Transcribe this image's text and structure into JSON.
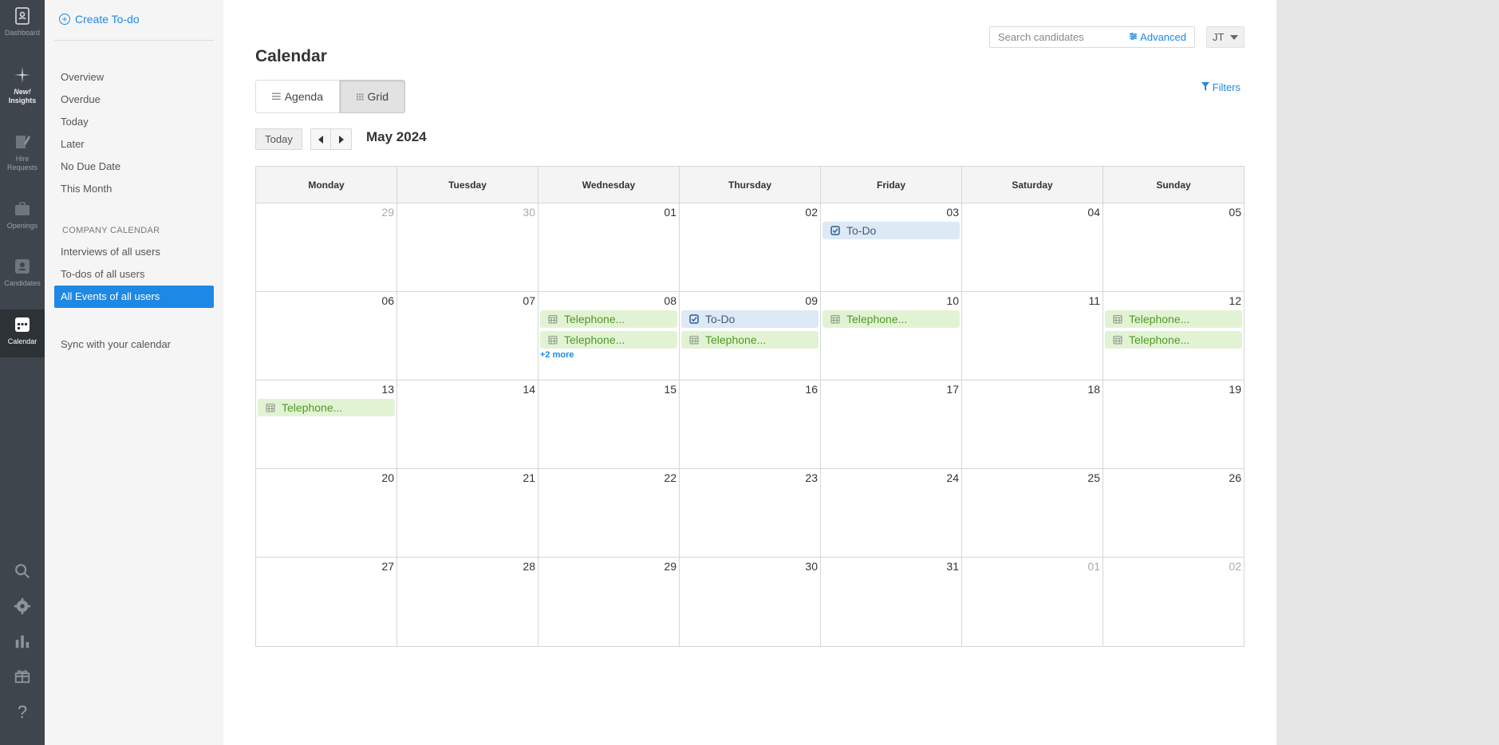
{
  "rail": {
    "items": [
      {
        "label": "Dashboard",
        "icon": "dashboard-icon"
      },
      {
        "label_top": "New!",
        "label": "Insights",
        "icon": "insights-icon"
      },
      {
        "label": "Hire Requests",
        "icon": "hire-requests-icon"
      },
      {
        "label": "Openings",
        "icon": "briefcase-icon"
      },
      {
        "label": "Candidates",
        "icon": "candidates-icon"
      },
      {
        "label": "Calendar",
        "icon": "calendar-icon"
      }
    ]
  },
  "sidebar": {
    "create_label": "Create To-do",
    "links": [
      "Overview",
      "Overdue",
      "Today",
      "Later",
      "No Due Date",
      "This Month"
    ],
    "company_header": "COMPANY CALENDAR",
    "company_links": [
      "Interviews of all users",
      "To-dos of all users",
      "All Events of all users"
    ],
    "sync_label": "Sync with your calendar"
  },
  "header": {
    "search_placeholder": "Search candidates",
    "advanced_label": "Advanced",
    "user_initials": "JT",
    "filters_label": "Filters"
  },
  "page": {
    "title": "Calendar",
    "view_agenda": "Agenda",
    "view_grid": "Grid",
    "today_label": "Today",
    "month_label": "May 2024"
  },
  "calendar": {
    "weekdays": [
      "Monday",
      "Tuesday",
      "Wednesday",
      "Thursday",
      "Friday",
      "Saturday",
      "Sunday"
    ],
    "weeks": [
      [
        {
          "d": "29",
          "other": true
        },
        {
          "d": "30",
          "other": true
        },
        {
          "d": "01"
        },
        {
          "d": "02"
        },
        {
          "d": "03",
          "events": [
            {
              "type": "todo",
              "label": "To-Do"
            }
          ]
        },
        {
          "d": "04"
        },
        {
          "d": "05"
        }
      ],
      [
        {
          "d": "06"
        },
        {
          "d": "07"
        },
        {
          "d": "08",
          "events": [
            {
              "type": "phone",
              "label": "Telephone..."
            },
            {
              "type": "phone",
              "label": "Telephone..."
            }
          ],
          "more": "+2 more"
        },
        {
          "d": "09",
          "events": [
            {
              "type": "todo",
              "label": "To-Do"
            },
            {
              "type": "phone",
              "label": "Telephone..."
            }
          ]
        },
        {
          "d": "10",
          "events": [
            {
              "type": "phone",
              "label": "Telephone..."
            }
          ]
        },
        {
          "d": "11"
        },
        {
          "d": "12",
          "events": [
            {
              "type": "phone",
              "label": "Telephone..."
            },
            {
              "type": "phone",
              "label": "Telephone..."
            }
          ]
        }
      ],
      [
        {
          "d": "13",
          "events": [
            {
              "type": "phone",
              "label": "Telephone..."
            }
          ]
        },
        {
          "d": "14"
        },
        {
          "d": "15"
        },
        {
          "d": "16"
        },
        {
          "d": "17"
        },
        {
          "d": "18"
        },
        {
          "d": "19"
        }
      ],
      [
        {
          "d": "20"
        },
        {
          "d": "21"
        },
        {
          "d": "22"
        },
        {
          "d": "23"
        },
        {
          "d": "24"
        },
        {
          "d": "25"
        },
        {
          "d": "26"
        }
      ],
      [
        {
          "d": "27"
        },
        {
          "d": "28"
        },
        {
          "d": "29"
        },
        {
          "d": "30"
        },
        {
          "d": "31"
        },
        {
          "d": "01",
          "other": true
        },
        {
          "d": "02",
          "other": true
        }
      ]
    ]
  },
  "colors": {
    "accent": "#1e88e5",
    "phone_event_bg": "#e2f3d4",
    "phone_event_text": "#4f9a23",
    "todo_event_bg": "#dde9f5"
  }
}
